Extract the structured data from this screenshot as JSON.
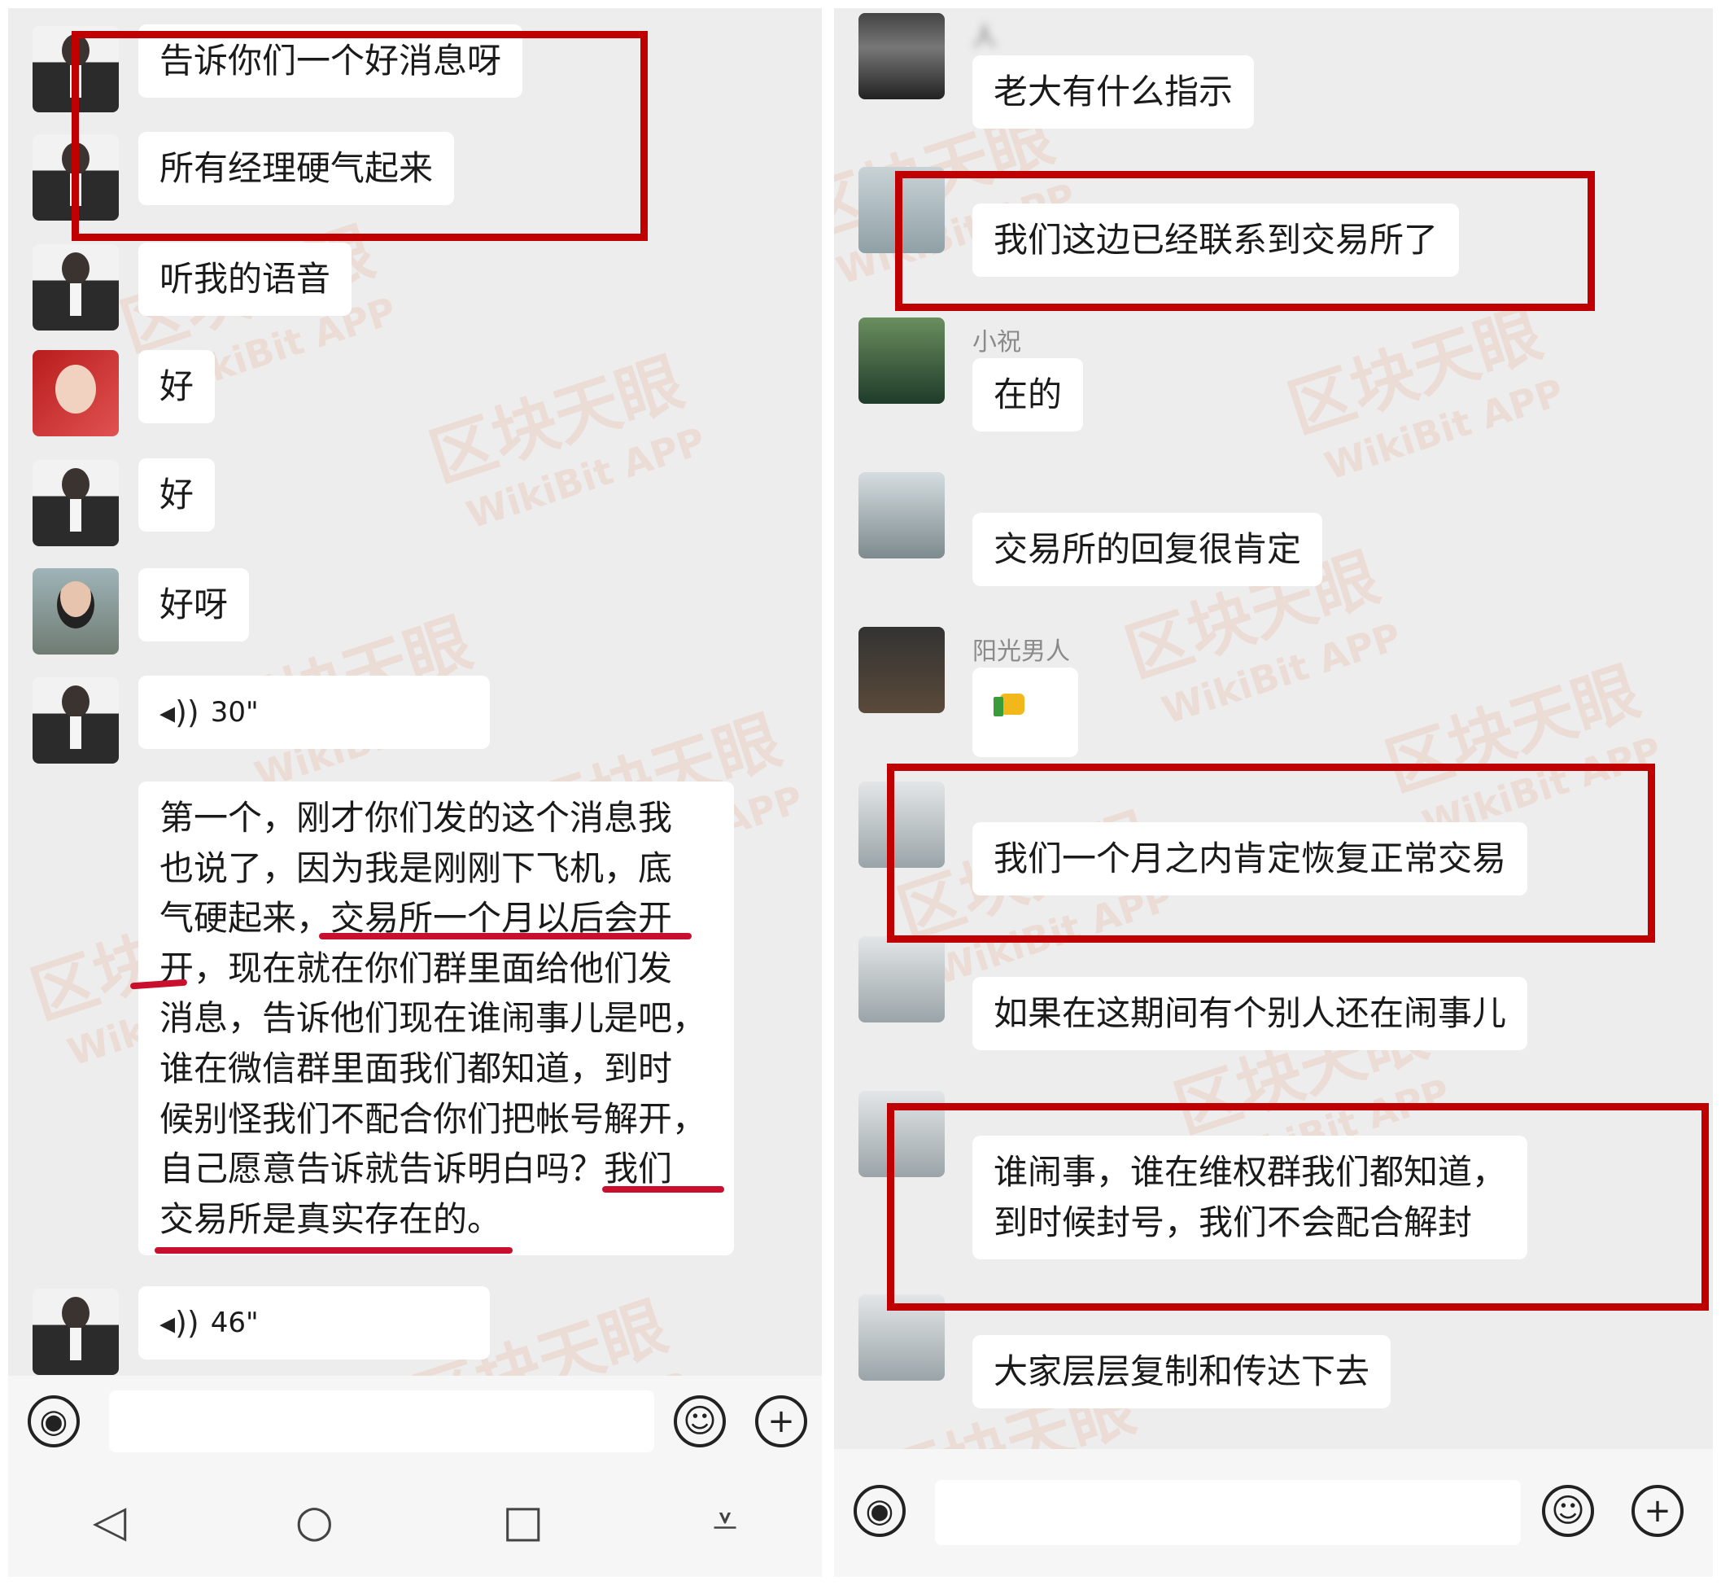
{
  "left": {
    "messages": {
      "m1": "告诉你们一个好消息呀",
      "m2": "所有经理硬气起来",
      "m3": "听我的语音",
      "m4": "好",
      "m5": "好",
      "m6": "好呀",
      "voice1": "30\"",
      "long": [
        "第一个，刚才你们发的这个消息我",
        "也说了，因为我是刚刚下飞机，底",
        "气硬起来，交易所一个月以后会开",
        "开，现在就在你们群里面给他们发",
        "消息，告诉他们现在谁闹事儿是吧，",
        "谁在微信群里面我们都知道，到时",
        "候别怪我们不配合你们把帐号解开，",
        "自己愿意告诉就告诉明白吗？我们",
        "交易所是真实存在的。"
      ],
      "voice2": "46\""
    },
    "input": {
      "voice_icon": "voice-icon",
      "emoji_icon": "emoji-icon",
      "plus_icon": "plus-icon"
    },
    "nav": {
      "back": "◁",
      "home": "○",
      "recent": "□",
      "menu": "⩡"
    }
  },
  "right": {
    "senders": {
      "s1": "人",
      "s3": "小祝",
      "s5": "阳光男人"
    },
    "messages": {
      "r1": "老大有什么指示",
      "r2": "我们这边已经联系到交易所了",
      "r3": "在的",
      "r4": "交易所的回复很肯定",
      "r5": "👍",
      "r6": "我们一个月之内肯定恢复正常交易",
      "r7": "如果在这期间有个别人还在闹事儿",
      "r8": [
        "谁闹事，谁在维权群我们都知道，",
        "到时候封号，我们不会配合解封"
      ],
      "r9": "大家层层复制和传达下去"
    },
    "input": {
      "voice_icon": "voice-icon",
      "emoji_icon": "emoji-icon",
      "plus_icon": "plus-icon"
    }
  },
  "watermark": {
    "cn": "区块天眼",
    "en": "WikiBit APP"
  },
  "colors": {
    "highlight_box": "#c00000",
    "underline": "#c8102e",
    "chat_bg": "#ededed",
    "bubble": "#ffffff"
  }
}
